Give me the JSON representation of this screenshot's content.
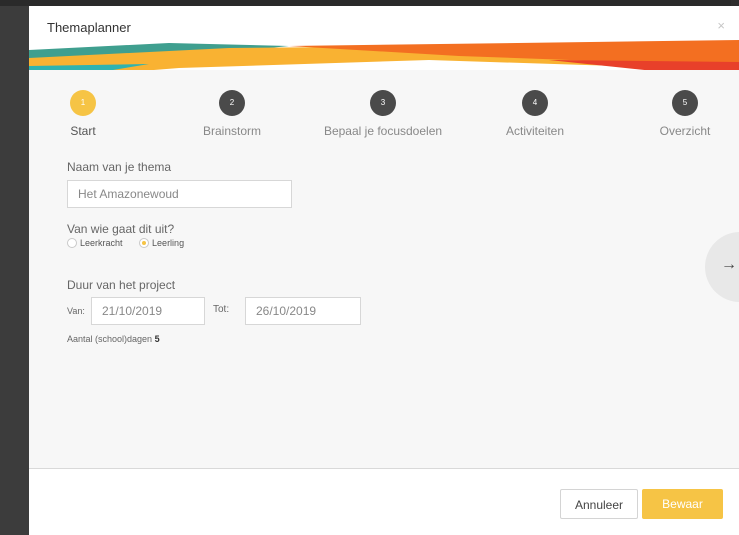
{
  "dialog": {
    "title": "Themaplanner",
    "close_icon": "×"
  },
  "steps": [
    {
      "number": "1",
      "label": "Start",
      "active": true
    },
    {
      "number": "2",
      "label": "Brainstorm",
      "active": false
    },
    {
      "number": "3",
      "label": "Bepaal je focusdoelen",
      "active": false
    },
    {
      "number": "4",
      "label": "Activiteiten",
      "active": false
    },
    {
      "number": "5",
      "label": "Overzicht",
      "active": false
    }
  ],
  "form": {
    "theme_name_label": "Naam van je thema",
    "theme_name_value": "Het Amazonewoud",
    "source_label": "Van wie gaat dit uit?",
    "radio_options": [
      {
        "label": "Leerkracht",
        "checked": false
      },
      {
        "label": "Leerling",
        "checked": true
      }
    ],
    "duration_label": "Duur van het project",
    "from_label": "Van:",
    "from_value": "21/10/2019",
    "to_label": "Tot:",
    "to_value": "26/10/2019",
    "days_label": "Aantal (school)dagen",
    "days_value": "5"
  },
  "next_icon": "→",
  "footer": {
    "cancel_label": "Annuleer",
    "save_label": "Bewaar"
  },
  "colors": {
    "accent": "#f6c445",
    "step_inactive": "#4a4a4a"
  }
}
